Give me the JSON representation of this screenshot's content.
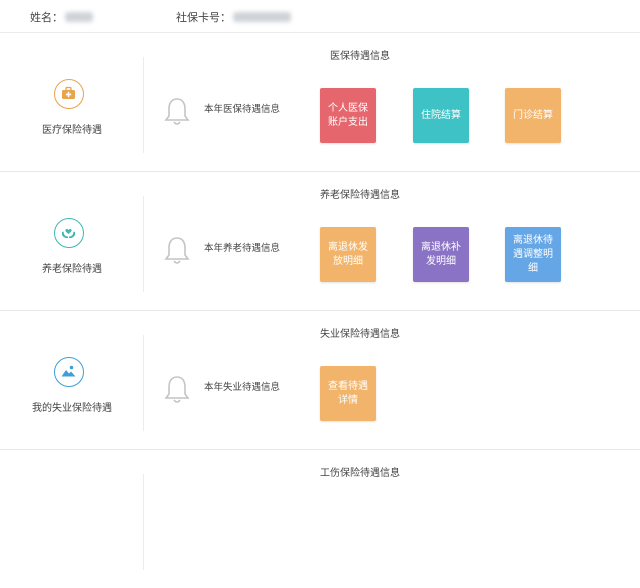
{
  "header": {
    "name_label": "姓名：",
    "card_label": "社保卡号："
  },
  "colors": {
    "red": "#e5676d",
    "cyan": "#3fc2c6",
    "orange": "#f1b46a",
    "purple": "#8a73c4",
    "blue": "#65a6e6",
    "medical_icon": "#e8a34b",
    "pension_icon": "#3fb7b3",
    "unemployment_icon": "#3f9fd6"
  },
  "sections": [
    {
      "title": "医保待遇信息",
      "left_label": "医疗保险待遇",
      "icon": "medical-kit-icon",
      "row_label": "本年医保待遇信息",
      "tiles": [
        "个人医保账户支出",
        "住院结算",
        "门诊结算"
      ]
    },
    {
      "title": "养老保险待遇信息",
      "left_label": "养老保险待遇",
      "icon": "hands-heart-icon",
      "row_label": "本年养老待遇信息",
      "tiles": [
        "离退休发放明细",
        "离退休补发明细",
        "离退休待遇调整明细"
      ]
    },
    {
      "title": "失业保险待遇信息",
      "left_label": "我的失业保险待遇",
      "icon": "landscape-icon",
      "row_label": "本年失业待遇信息",
      "tiles": [
        "查看待遇详情"
      ]
    },
    {
      "title": "工伤保险待遇信息"
    }
  ]
}
